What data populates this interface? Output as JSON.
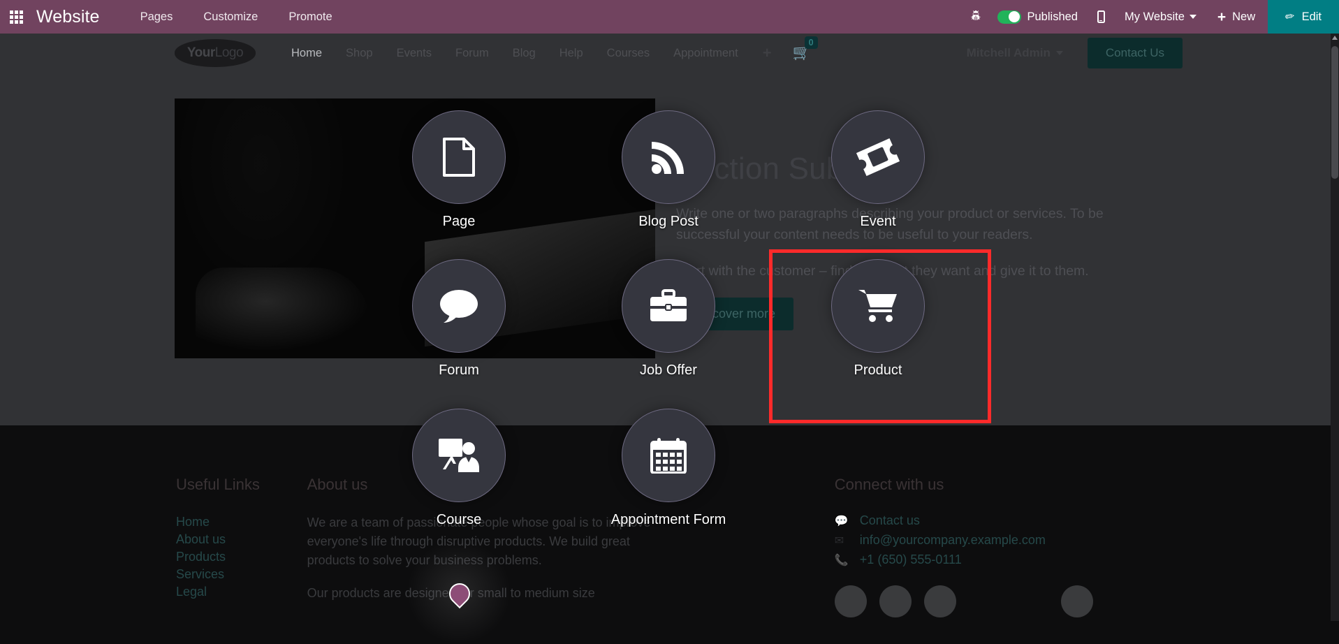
{
  "topbar": {
    "apps_icon": "apps-grid-icon",
    "brand": "Website",
    "menu": [
      "Pages",
      "Customize",
      "Promote"
    ],
    "bug_icon": "bug-icon",
    "publish_label": "Published",
    "mobile_icon": "mobile-preview-icon",
    "website_selector": "My Website",
    "new_label": "New",
    "edit_label": "Edit",
    "accent_teal": "#017e84",
    "bar_purple": "#71435f",
    "toggle_green": "#21b35a"
  },
  "site_nav": {
    "logo_bold": "Your",
    "logo_light": "Logo",
    "links": [
      "Home",
      "Shop",
      "Events",
      "Forum",
      "Blog",
      "Help",
      "Courses",
      "Appointment"
    ],
    "active_link": "Home",
    "plus_label": "+",
    "cart_icon": "shopping-cart-icon",
    "cart_count": "0",
    "user": "Mitchell Admin",
    "contact_button": "Contact Us"
  },
  "hero": {
    "title": "Section Subtitle",
    "paragraph_1": "Write one or two paragraphs describing your product or services. To be successful your content needs to be useful to your readers.",
    "paragraph_2": "Start with the customer – find out what they want and give it to them.",
    "cta": "Discover more"
  },
  "footer": {
    "useful_links_title": "Useful Links",
    "useful_links": [
      "Home",
      "About us",
      "Products",
      "Services",
      "Legal"
    ],
    "about_title": "About us",
    "about_p1": "We are a team of passionate people whose goal is to improve everyone's life through disruptive products. We build great products to solve your business problems.",
    "about_p2": "Our products are designed for small to medium size",
    "connect_title": "Connect with us",
    "contact_us": "Contact us",
    "email": "info@yourcompany.example.com",
    "phone": "+1 (650) 555-0111",
    "contact_icon": "comment-icon",
    "email_icon": "envelope-icon",
    "phone_icon": "phone-icon"
  },
  "block_picker": {
    "highlight_color": "#fe2a2a",
    "blocks": [
      {
        "label": "Page",
        "icon": "file-document-icon"
      },
      {
        "label": "Blog Post",
        "icon": "rss-feed-icon"
      },
      {
        "label": "Event",
        "icon": "ticket-icon"
      },
      {
        "label": "Forum",
        "icon": "comment-bubble-icon"
      },
      {
        "label": "Job Offer",
        "icon": "briefcase-icon"
      },
      {
        "label": "Product",
        "icon": "shopping-cart-icon"
      },
      {
        "label": "Course",
        "icon": "presentation-teacher-icon"
      },
      {
        "label": "Appointment Form",
        "icon": "calendar-icon"
      }
    ],
    "selected": "Product"
  }
}
